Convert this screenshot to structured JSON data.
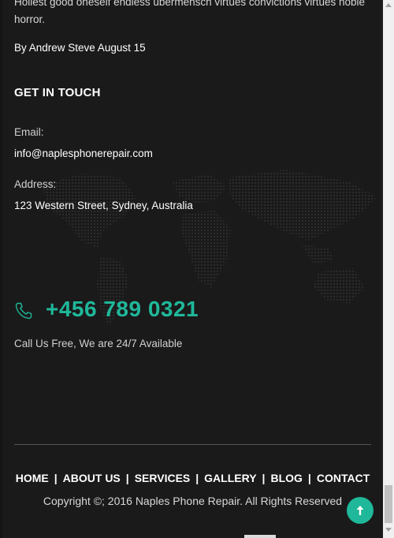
{
  "blog_snippet": {
    "text": "Holiest good oneself endless ubermensch virtues convictions virtues noble horror.",
    "byline": "By Andrew Steve August 15"
  },
  "contact": {
    "heading": "GET IN TOUCH",
    "email_label": "Email:",
    "email_value": "info@naplesphonerepair.com",
    "address_label": "Address:",
    "address_value": "123 Western Street, Sydney, Australia",
    "phone_icon": "phone-icon",
    "phone": "+456 789 0321",
    "availability": "Call Us Free, We are 24/7 Available"
  },
  "footer": {
    "nav": [
      "HOME",
      "ABOUT US",
      "SERVICES",
      "GALLERY",
      "BLOG",
      "CONTACT"
    ],
    "separator": "|",
    "copyright": "Copyright ©; 2016 Naples Phone Repair. All Rights Reserved",
    "back_to_top_icon": "arrow-up-icon"
  },
  "colors": {
    "accent": "#1fb89a",
    "background": "#1a1a1a"
  }
}
